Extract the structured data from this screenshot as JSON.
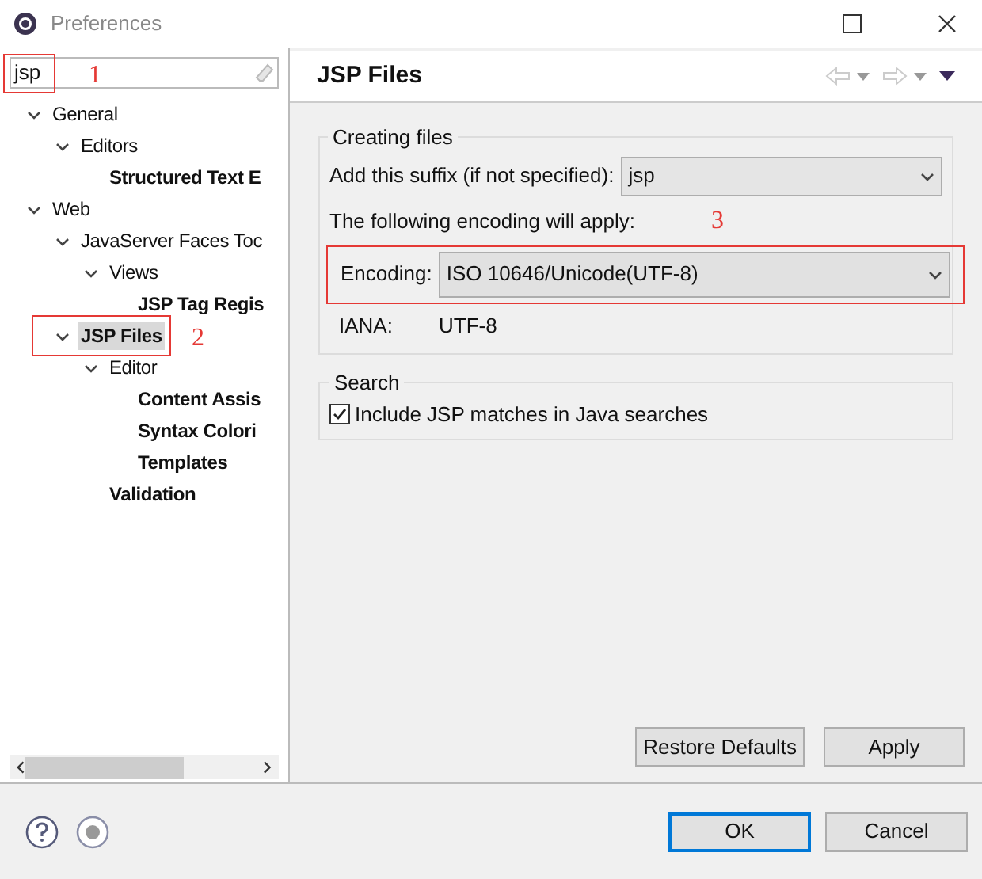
{
  "window": {
    "title": "Preferences"
  },
  "filter": {
    "value": "jsp"
  },
  "tree": [
    {
      "label": "General",
      "matched": false,
      "selected": false,
      "expanded": true,
      "children": [
        {
          "label": "Editors",
          "matched": false,
          "selected": false,
          "expanded": true,
          "children": [
            {
              "label": "Structured Text E",
              "matched": true,
              "selected": false
            }
          ]
        }
      ]
    },
    {
      "label": "Web",
      "matched": false,
      "selected": false,
      "expanded": true,
      "children": [
        {
          "label": "JavaServer Faces Toc",
          "matched": false,
          "selected": false,
          "expanded": true,
          "children": [
            {
              "label": "Views",
              "matched": false,
              "selected": false,
              "expanded": true,
              "children": [
                {
                  "label": "JSP Tag Regis",
                  "matched": true,
                  "selected": false
                }
              ]
            }
          ]
        },
        {
          "label": "JSP Files",
          "matched": true,
          "selected": true,
          "expanded": true,
          "children": [
            {
              "label": "Editor",
              "matched": false,
              "selected": false,
              "expanded": true,
              "children": [
                {
                  "label": "Content Assis",
                  "matched": true,
                  "selected": false
                },
                {
                  "label": "Syntax Colori",
                  "matched": true,
                  "selected": false
                },
                {
                  "label": "Templates",
                  "matched": true,
                  "selected": false
                }
              ]
            },
            {
              "label": "Validation",
              "matched": true,
              "selected": false
            }
          ]
        }
      ]
    }
  ],
  "page": {
    "title": "JSP Files",
    "creating_files": {
      "legend": "Creating files",
      "suffix_label": "Add this suffix (if not specified):",
      "suffix_value": "jsp",
      "encoding_note": "The following encoding will apply:",
      "encoding_label": "Encoding:",
      "encoding_value": "ISO 10646/Unicode(UTF-8)",
      "iana_label": "IANA:",
      "iana_value": "UTF-8"
    },
    "search": {
      "legend": "Search",
      "checkbox": {
        "label": "Include JSP matches in Java searches",
        "checked": true
      }
    },
    "buttons": [
      "Restore Defaults",
      "Apply"
    ]
  },
  "dialog_buttons": [
    {
      "label": "OK",
      "selected": true
    },
    {
      "label": "Cancel",
      "selected": false
    }
  ],
  "annotations": [
    "1",
    "2",
    "3"
  ]
}
